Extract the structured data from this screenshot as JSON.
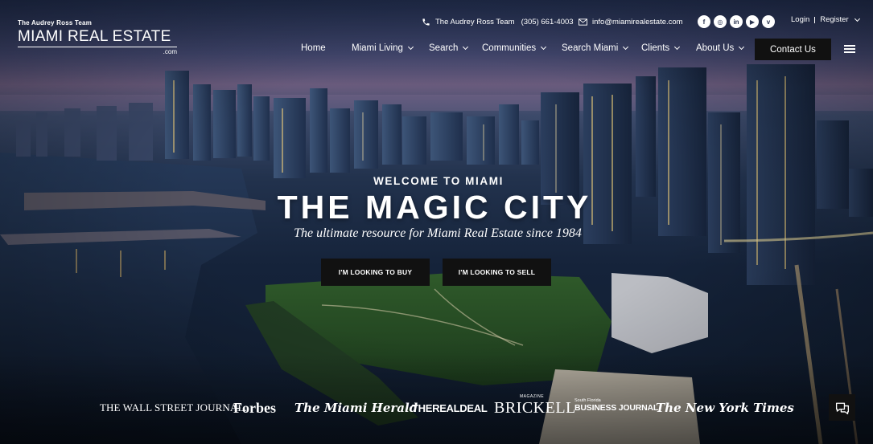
{
  "branding": {
    "team": "The Audrey Ross Team",
    "name": "MIAMI REAL ESTATE",
    "domain_suffix": ".com"
  },
  "utility": {
    "phone_label": "The Audrey Ross Team",
    "phone_number": "(305) 661-4003",
    "email": "info@miamirealestate.com",
    "social": [
      {
        "icon": "facebook-icon",
        "glyph": "f"
      },
      {
        "icon": "instagram-icon",
        "glyph": "◎"
      },
      {
        "icon": "linkedin-icon",
        "glyph": "in"
      },
      {
        "icon": "youtube-icon",
        "glyph": "▶"
      },
      {
        "icon": "vimeo-icon",
        "glyph": "v"
      }
    ],
    "login": "Login",
    "register": "Register"
  },
  "nav": {
    "items": [
      {
        "label": "Home",
        "dropdown": false
      },
      {
        "label": "Miami Living",
        "dropdown": true
      },
      {
        "label": "Search",
        "dropdown": true
      },
      {
        "label": "Communities",
        "dropdown": true
      },
      {
        "label": "Search Miami",
        "dropdown": true
      },
      {
        "label": "Clients",
        "dropdown": true
      },
      {
        "label": "About Us",
        "dropdown": true
      }
    ],
    "contact": "Contact Us"
  },
  "hero": {
    "kicker": "WELCOME TO MIAMI",
    "headline": "THE MAGIC CITY",
    "tagline": "The ultimate resource for Miami Real Estate since 1984",
    "buy_button": "I'M LOOKING TO BUY",
    "sell_button": "I'M LOOKING TO SELL"
  },
  "press": {
    "wsj": "THE WALL STREET JOURNAL.",
    "forbes": "Forbes",
    "herald": "The Miami Herald",
    "realdeal": "THEREALDEAL",
    "brickell_magazine": "MAGAZINE",
    "brickell": "BRICKELL",
    "bj_region": "South Florida",
    "bj_name": "BUSINESS JOURNAL",
    "nyt": "The New York Times"
  },
  "colors": {
    "button_bg": "#111111",
    "text": "#ffffff",
    "sky_top": "#2e3f66",
    "horizon": "#6b5c7e",
    "water": "#15233a"
  }
}
